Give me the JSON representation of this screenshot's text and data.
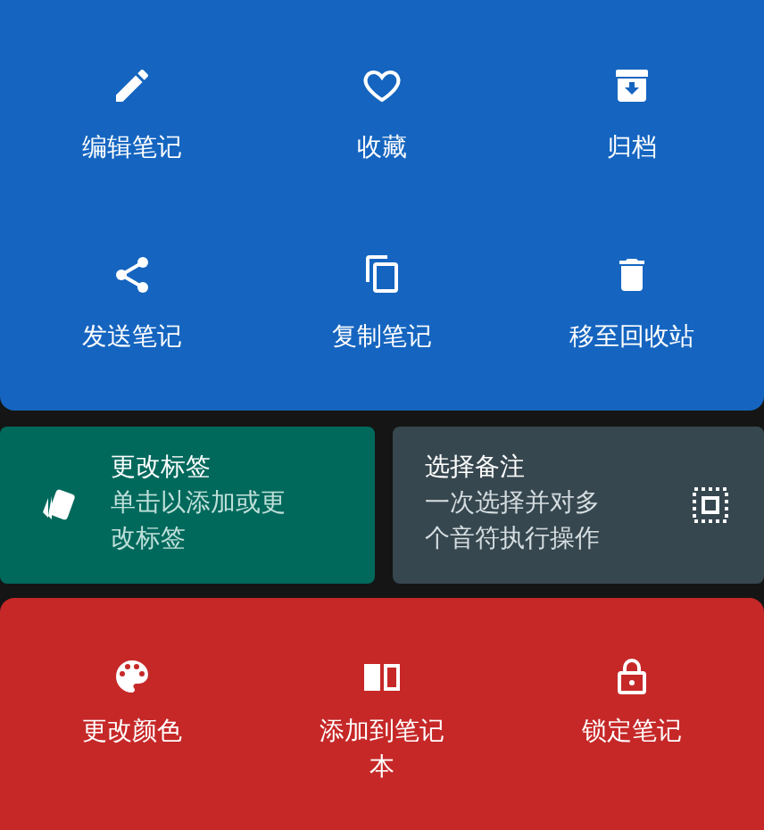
{
  "note_actions": [
    {
      "label": "编辑笔记"
    },
    {
      "label": "收藏"
    },
    {
      "label": "归档"
    },
    {
      "label": "发送笔记"
    },
    {
      "label": "复制笔记"
    },
    {
      "label": "移至回收站"
    }
  ],
  "cards": [
    {
      "title": "更改标签",
      "subtitle": "单击以添加或更改标签"
    },
    {
      "title": "选择备注",
      "subtitle": "一次选择并对多个音符执行操作"
    }
  ],
  "more_actions": [
    {
      "label": "更改颜色"
    },
    {
      "label": "添加到笔记本"
    },
    {
      "label": "锁定笔记"
    }
  ]
}
